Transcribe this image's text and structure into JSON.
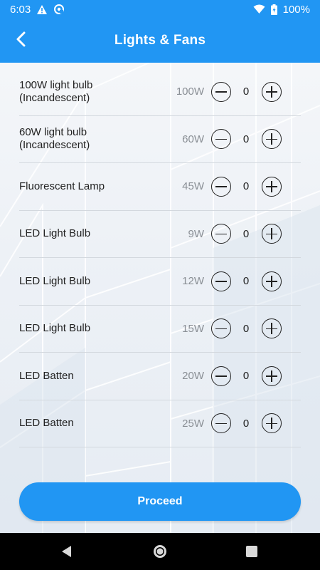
{
  "status_bar": {
    "time": "6:03",
    "battery": "100%",
    "icons": [
      "warning-icon",
      "sync-icon",
      "wifi-icon",
      "battery-icon"
    ]
  },
  "app_bar": {
    "title": "Lights & Fans",
    "back_icon": "chevron-left-icon"
  },
  "items": [
    {
      "label": "100W light bulb\n(Incandescent)",
      "watt": "100W",
      "qty": "0"
    },
    {
      "label": "60W light bulb\n(Incandescent)",
      "watt": "60W",
      "qty": "0"
    },
    {
      "label": "Fluorescent Lamp",
      "watt": "45W",
      "qty": "0"
    },
    {
      "label": "LED Light Bulb",
      "watt": "9W",
      "qty": "0"
    },
    {
      "label": "LED Light Bulb",
      "watt": "12W",
      "qty": "0"
    },
    {
      "label": "LED Light Bulb",
      "watt": "15W",
      "qty": "0"
    },
    {
      "label": "LED Batten",
      "watt": "20W",
      "qty": "0"
    },
    {
      "label": "LED Batten",
      "watt": "25W",
      "qty": "0"
    }
  ],
  "proceed_label": "Proceed",
  "nav_bar": {
    "icons": [
      "back-triangle-icon",
      "home-circle-icon",
      "recents-square-icon"
    ]
  },
  "colors": {
    "primary": "#2196f3",
    "text": "#222222",
    "watt_text": "#8a8f95"
  }
}
